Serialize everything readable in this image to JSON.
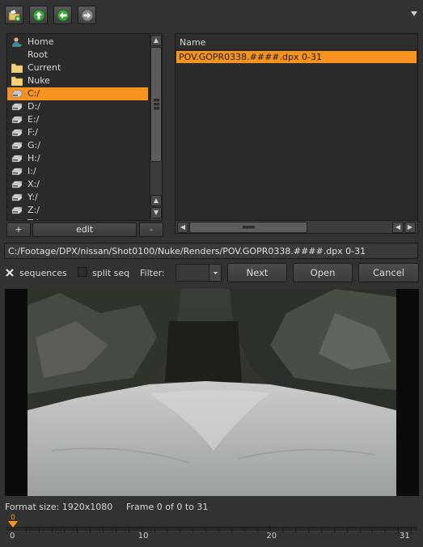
{
  "toolbar": {
    "buttons": [
      {
        "icon": "new-folder-icon"
      },
      {
        "icon": "up-arrow-icon"
      },
      {
        "icon": "back-arrow-icon"
      },
      {
        "icon": "forward-arrow-icon"
      }
    ],
    "menu_icon": "dropdown-triangle-icon"
  },
  "dirs": [
    {
      "label": "Home",
      "icon": "home-user-icon"
    },
    {
      "label": "Root",
      "icon": "none"
    },
    {
      "label": "Current",
      "icon": "folder-icon"
    },
    {
      "label": "Nuke",
      "icon": "folder-icon"
    },
    {
      "label": "C:/",
      "icon": "drive-icon",
      "selected": true
    },
    {
      "label": "D:/",
      "icon": "drive-icon"
    },
    {
      "label": "E:/",
      "icon": "drive-icon"
    },
    {
      "label": "F:/",
      "icon": "drive-icon"
    },
    {
      "label": "G:/",
      "icon": "drive-icon"
    },
    {
      "label": "H:/",
      "icon": "drive-icon"
    },
    {
      "label": "I:/",
      "icon": "drive-icon"
    },
    {
      "label": "X:/",
      "icon": "drive-icon"
    },
    {
      "label": "Y:/",
      "icon": "drive-icon"
    },
    {
      "label": "Z:/",
      "icon": "drive-icon"
    },
    {
      "label": "T:/",
      "icon": "drive-icon"
    }
  ],
  "dir_buttons": {
    "add": "+",
    "edit": "edit",
    "remove": "-"
  },
  "files": {
    "header": "Name",
    "rows": [
      {
        "label": "POV.GOPR0338.####.dpx 0-31",
        "selected": true
      }
    ]
  },
  "path": "C:/Footage/DPX/nissan/Shot0100/Nuke/Renders/POV.GOPR0338.####.dpx 0-31",
  "options": {
    "sequences_label": "sequences",
    "sequences_checked": true,
    "split_seq_label": "split seq",
    "split_seq_checked": false,
    "filter_label": "Filter:",
    "filter_value": ""
  },
  "buttons": {
    "next": "Next",
    "open": "Open",
    "cancel": "Cancel"
  },
  "info": {
    "format": "Format size: 1920x1080",
    "frame": "Frame 0 of 0 to 31"
  },
  "timeline": {
    "current": "0",
    "labels": [
      "0",
      "10",
      "20",
      "31"
    ],
    "start": 0,
    "end": 31,
    "position": 0
  },
  "colors": {
    "accent": "#f7931e",
    "background": "#323232"
  }
}
